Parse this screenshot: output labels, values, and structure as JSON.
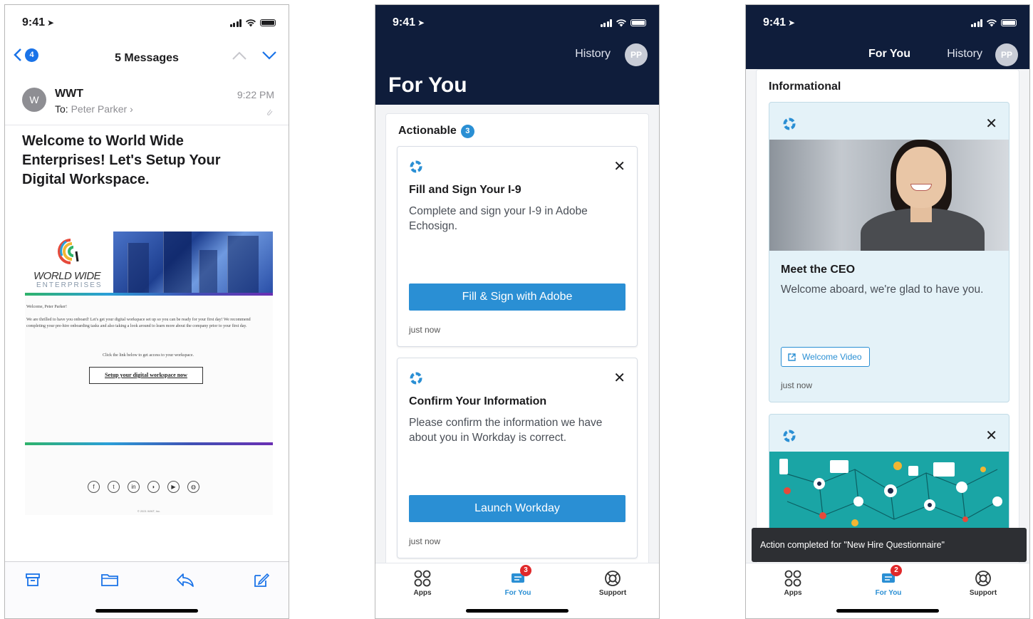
{
  "status_time": "9:41",
  "mail": {
    "unread_count": "4",
    "title": "5 Messages",
    "sender": "WWT",
    "sender_initial": "W",
    "to_label": "To:",
    "to_name": "Peter Parker",
    "time": "9:22 PM",
    "subject": "Welcome to World Wide Enterprises! Let's Setup Your Digital Workspace.",
    "email": {
      "logo_text": "WORLD WIDE",
      "logo_sub": "ENTERPRISES",
      "greeting": "Welcome, Peter Parker!",
      "paragraph": "We are thrilled to have you onboard! Let's get your digital workspace set up so you can be ready for your first day! We recommend completing your pre-hire onboarding tasks and also taking a look around to learn more about the company prior to your first day.",
      "click_text": "Click the link below to get access to your workspace.",
      "setup_link": "Setup your digital workspace now",
      "social_icons": [
        "facebook-icon",
        "twitter-icon",
        "linkedin-icon",
        "rss-icon",
        "youtube-icon",
        "globe-icon"
      ],
      "copyright": "© 2021 WWT, Inc."
    },
    "toolbar_icons": [
      "archive-icon",
      "folder-icon",
      "reply-icon",
      "compose-icon"
    ]
  },
  "app": {
    "nav_history": "History",
    "nav_foryou": "For You",
    "avatar_initials": "PP",
    "page_title": "For You",
    "actionable": {
      "label": "Actionable",
      "count": "3",
      "cards": [
        {
          "title": "Fill and Sign Your I-9",
          "description": "Complete and sign your I-9 in Adobe Echosign.",
          "button": "Fill & Sign with Adobe",
          "timestamp": "just now"
        },
        {
          "title": "Confirm Your Information",
          "description": "Please confirm the information we have about you in Workday is correct.",
          "button": "Launch Workday",
          "timestamp": "just now"
        }
      ]
    },
    "informational": {
      "label": "Informational",
      "cards": [
        {
          "title": "Meet the CEO",
          "description": "Welcome aboard, we're glad to have you.",
          "button": "Welcome Video",
          "timestamp": "just now"
        }
      ]
    },
    "toast": "Action completed for \"New Hire Questionnaire\"",
    "tabs": {
      "apps": "Apps",
      "foryou": "For You",
      "support": "Support",
      "foryou_badge_screen2": "3",
      "foryou_badge_screen3": "2"
    },
    "colors": {
      "header": "#0f1d3b",
      "accent": "#2a8fd4",
      "info_card": "#e4f2f8",
      "badge_red": "#e0282a"
    }
  }
}
